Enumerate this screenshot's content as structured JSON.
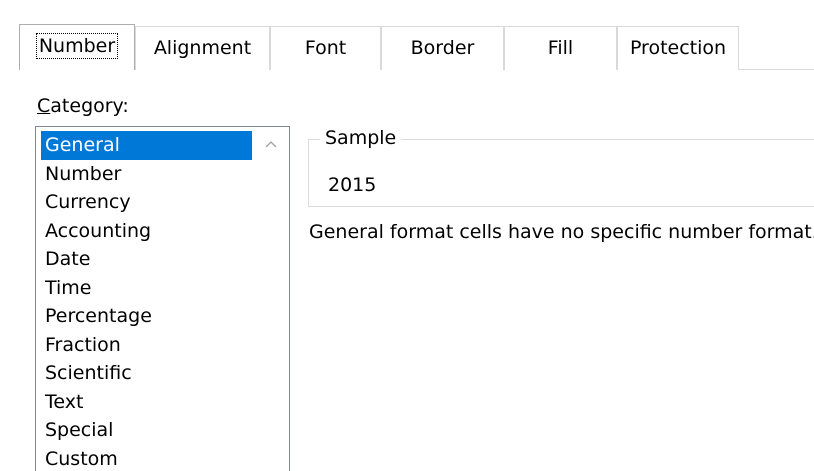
{
  "tabs": [
    {
      "label": "Number",
      "active": true
    },
    {
      "label": "Alignment",
      "active": false
    },
    {
      "label": "Font",
      "active": false
    },
    {
      "label": "Border",
      "active": false
    },
    {
      "label": "Fill",
      "active": false
    },
    {
      "label": "Protection",
      "active": false
    }
  ],
  "category": {
    "label_mnemonic": "C",
    "label_rest": "ategory:",
    "items": [
      "General",
      "Number",
      "Currency",
      "Accounting",
      "Date",
      "Time",
      "Percentage",
      "Fraction",
      "Scientific",
      "Text",
      "Special",
      "Custom"
    ],
    "selected": "General"
  },
  "sample": {
    "legend": "Sample",
    "value": "2015"
  },
  "description": "General format cells have no specific number format.",
  "colors": {
    "selection": "#0078d7",
    "selection_text": "#ffffff",
    "tab_border": "#d9d9d9",
    "listbox_border": "#828790"
  },
  "icons": {
    "scroll_up": "chevron-up-icon"
  }
}
